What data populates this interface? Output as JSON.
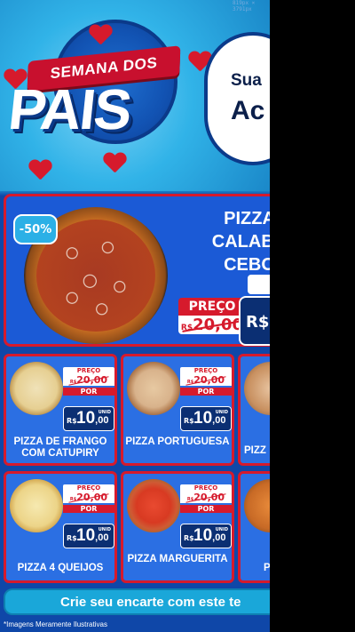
{
  "dimensions_label": "819px × 3791px",
  "hero": {
    "badge_text": "SEMANA DOS",
    "title_big": "PAIS",
    "card_line1": "Sua",
    "card_line2": "Ac"
  },
  "feature": {
    "discount": "-50%",
    "title_lines": [
      "PIZZA",
      "CALABR",
      "CEBO"
    ],
    "price_label": "PREÇO",
    "old_price_currency": "R$",
    "old_price_value": "20,00",
    "new_price_currency": "R$"
  },
  "cards": [
    {
      "name": "PIZZA DE FRANGO COM CATUPIRY",
      "price_label": "PREÇO",
      "old": "20,00",
      "old_currency": "R$",
      "por": "POR",
      "currency": "R$",
      "value": "10",
      "cents": ",00",
      "unit": "UNID"
    },
    {
      "name": "PIZZA PORTUGUESA",
      "price_label": "PREÇO",
      "old": "20,00",
      "old_currency": "R$",
      "por": "POR",
      "currency": "R$",
      "value": "10",
      "cents": ",00",
      "unit": "UNID"
    },
    {
      "name": "PIZZA 4 QUEIJOS",
      "price_label": "PREÇO",
      "old": "20,00",
      "old_currency": "R$",
      "por": "POR",
      "currency": "R$",
      "value": "10",
      "cents": ",00",
      "unit": "UNID"
    },
    {
      "name": "PIZZA MARGUERITA",
      "price_label": "PREÇO",
      "old": "20,00",
      "old_currency": "R$",
      "por": "POR",
      "currency": "R$",
      "value": "10",
      "cents": ",00",
      "unit": "UNID"
    }
  ],
  "partial_cards": [
    {
      "name": "PIZZ"
    },
    {
      "name": "P"
    }
  ],
  "cta": "Crie seu encarte com este te",
  "disclaimer": "*Imagens Meramente Ilustrativas"
}
